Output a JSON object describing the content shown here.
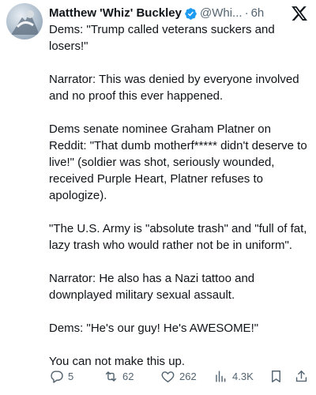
{
  "tweet": {
    "display_name": "Matthew 'Whiz' Buckley",
    "handle": "@Whi...",
    "separator": "·",
    "time": "6h",
    "paragraphs": [
      "Dems: \"Trump called veterans suckers and losers!\"",
      "Narrator: This was denied by everyone involved and no proof this ever happened.",
      "Dems senate nominee Graham Platner on Reddit: \"That dumb motherf***** didn't deserve to live!\" (soldier was shot, seriously wounded, received Purple Heart, Platner refuses to apologize).",
      "\"The U.S. Army is \"absolute trash\" and \"full of fat, lazy trash who would rather not be in uniform\".",
      "Narrator: He also has a Nazi tattoo and downplayed military sexual assault.",
      "Dems: \"He's our guy! He's AWESOME!\"",
      "You can not make this up."
    ]
  },
  "actions": {
    "replies": "5",
    "reposts": "62",
    "likes": "262",
    "views": "4.3K"
  },
  "icons": {
    "verified": "verified-badge-icon",
    "x_logo": "x-logo-icon",
    "reply": "reply-icon",
    "repost": "repost-icon",
    "like": "heart-icon",
    "views": "views-icon",
    "bookmark": "bookmark-icon",
    "share": "share-icon"
  },
  "colors": {
    "text": "#0f1419",
    "secondary": "#536471",
    "verified": "#1d9bf0"
  }
}
